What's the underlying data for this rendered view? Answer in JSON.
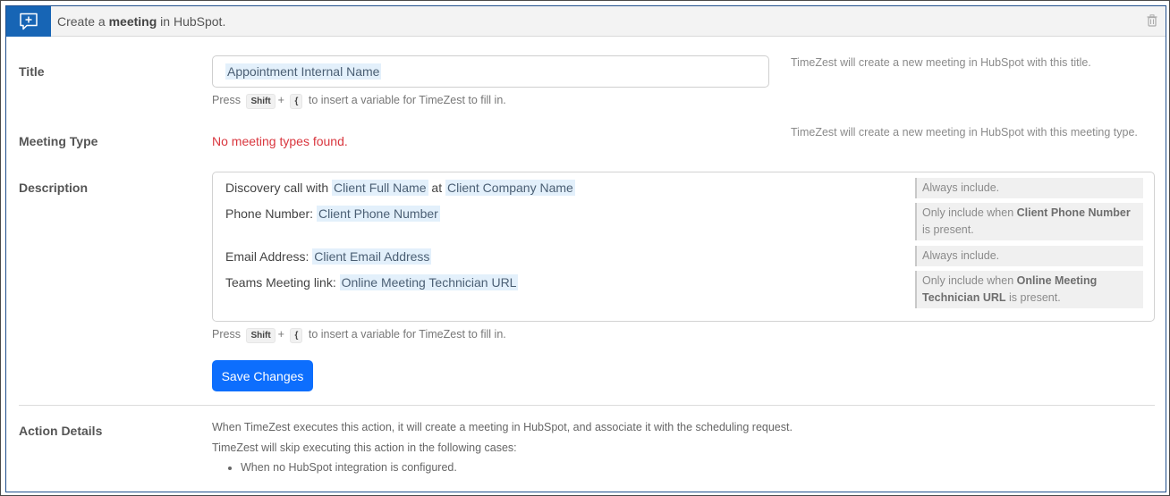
{
  "header": {
    "title_prefix": "Create a ",
    "title_bold": "meeting",
    "title_suffix": " in HubSpot."
  },
  "title_field": {
    "label": "Title",
    "value": "Appointment Internal Name",
    "help": "TimeZest will create a new meeting in HubSpot with this title.",
    "hint_press": "Press",
    "hint_key1": "Shift",
    "hint_plus": "+",
    "hint_key2": "{",
    "hint_rest": "to insert a variable for TimeZest to fill in."
  },
  "meeting_type": {
    "label": "Meeting Type",
    "error": "No meeting types found.",
    "help": "TimeZest will create a new meeting in HubSpot with this meeting type."
  },
  "description": {
    "label": "Description",
    "lines": [
      {
        "parts": [
          "Discovery call with ",
          "Client Full Name",
          " at ",
          "Client Company Name"
        ],
        "note_pre": "Always include.",
        "note_bold": "",
        "note_post": ""
      },
      {
        "parts": [
          "Phone Number: ",
          "Client Phone Number"
        ],
        "note_pre": "Only include when ",
        "note_bold": "Client Phone Number",
        "note_post": " is present."
      },
      {
        "parts": [
          "Email Address: ",
          "Client Email Address"
        ],
        "note_pre": "Always include.",
        "note_bold": "",
        "note_post": ""
      },
      {
        "parts": [
          "Teams Meeting link: ",
          "Online Meeting Technician URL"
        ],
        "note_pre": "Only include when ",
        "note_bold": "Online Meeting Technician URL",
        "note_post": " is present."
      }
    ],
    "hint_press": "Press",
    "hint_key1": "Shift",
    "hint_plus": "+",
    "hint_key2": "{",
    "hint_rest": "to insert a variable for TimeZest to fill in."
  },
  "save_button": "Save Changes",
  "action_details": {
    "label": "Action Details",
    "line1": "When TimeZest executes this action, it will create a meeting in HubSpot, and associate it with the scheduling request.",
    "line2": "TimeZest will skip executing this action in the following cases:",
    "bullets": [
      "When no HubSpot integration is configured."
    ]
  },
  "icons": {
    "header_icon": "add-comment-icon",
    "delete_icon": "trash-icon"
  },
  "colors": {
    "accent": "#1765b5",
    "button": "#0d6efd",
    "error": "#d9363e",
    "chip_bg": "#e3f0fb"
  }
}
